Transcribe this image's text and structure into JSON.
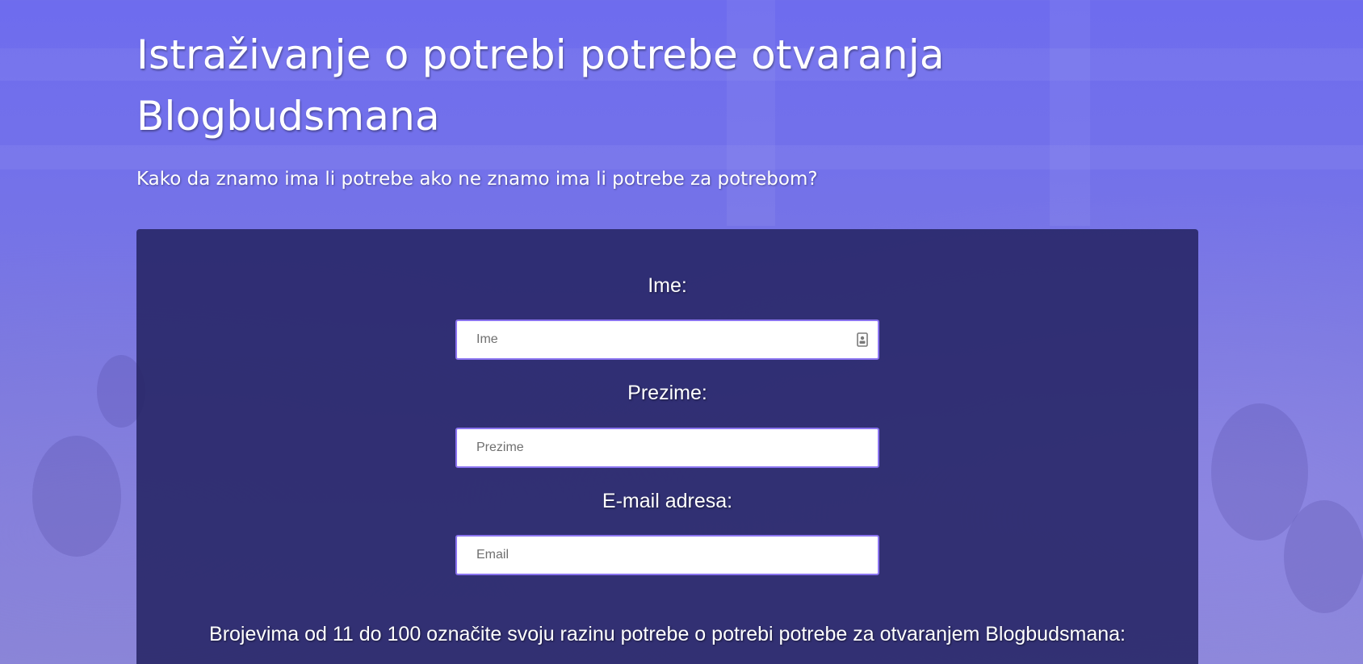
{
  "header": {
    "title": "Istraživanje o potrebi potrebe otvaranja Blogbudsmana",
    "subtitle": "Kako da znamo ima li potrebe ako ne znamo ima li potrebe za potrebom?"
  },
  "form": {
    "first_name": {
      "label": "Ime:",
      "placeholder": "Ime",
      "value": "",
      "icon": "contact-card-icon"
    },
    "last_name": {
      "label": "Prezime:",
      "placeholder": "Prezime",
      "value": ""
    },
    "email": {
      "label": "E-mail adresa:",
      "placeholder": "Email",
      "value": ""
    },
    "scale_question": "Brojevima od 11 do 100 označite svoju razinu potrebe o potrebi potrebe za otvaranjem Blogbudsmana:"
  },
  "colors": {
    "background": "#6e6cee",
    "panel": "#26246a",
    "input_border": "#8b74f0",
    "text": "#ffffff"
  }
}
